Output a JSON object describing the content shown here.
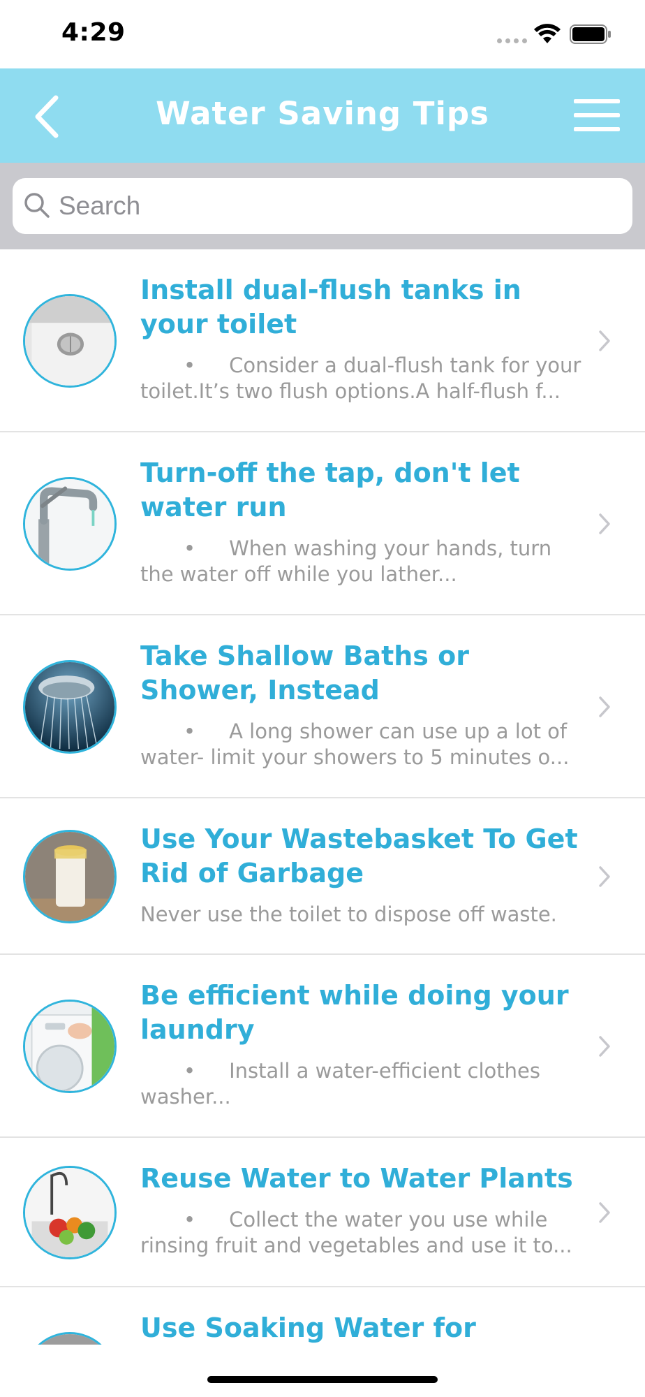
{
  "status_bar": {
    "time": "4:29"
  },
  "nav": {
    "title": "Water Saving Tips",
    "back_icon": "chevron-left-icon",
    "menu_icon": "hamburger-menu-icon"
  },
  "search": {
    "placeholder": "Search",
    "value": ""
  },
  "colors": {
    "nav_background": "#8fdcf0",
    "title_text": "#30aed8",
    "description_text": "#9a9a9a",
    "search_area_background": "#c9c9ce",
    "thumbnail_border": "#2fb4dc"
  },
  "tips": [
    {
      "title": "Install dual-flush tanks in your toilet",
      "bullet": "•",
      "description": "Consider a dual-flush tank for your toilet.It’s two flush options.A half-flush f...",
      "image": "toilet-flush-button-image"
    },
    {
      "title": "Turn-off the tap, don't let water run",
      "bullet": "•",
      "description": "When washing your hands, turn the water off while you lather...",
      "image": "water-tap-image"
    },
    {
      "title": "Take Shallow Baths or Shower, Instead",
      "bullet": "•",
      "description": "A long shower can use up a lot of water- limit your showers to 5 minutes o...",
      "image": "shower-head-image"
    },
    {
      "title": "Use Your Wastebasket To Get Rid of Garbage",
      "bullet": "",
      "description": "Never use the toilet to dispose off waste.",
      "image": "wastebasket-image"
    },
    {
      "title": "Be efficient while doing your laundry",
      "bullet": "•",
      "description": "Install a water-efficient clothes washer...",
      "image": "washing-machine-image"
    },
    {
      "title": "Reuse Water to Water Plants",
      "bullet": "•",
      "description": "Collect the water you use while rinsing fruit and vegetables and use it to...",
      "image": "sink-vegetables-image"
    },
    {
      "title": "Use Soaking Water for",
      "bullet": "",
      "description": "",
      "image": "soaking-water-image"
    }
  ]
}
